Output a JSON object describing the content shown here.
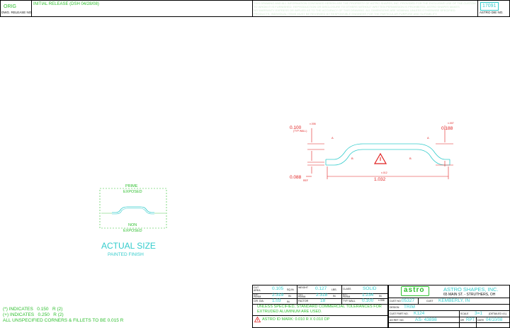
{
  "header": {
    "rev": "ORIG",
    "rev_label": "DWG. RELEASE NO.",
    "release_note": "INITIAL RELEASE (DSH 04/28/08)",
    "disclaimer_line1": "THIS DRAWING AND ALL INFORMATION CONTAINED HEREIN ARE THE PROPERTY OF ASTRO SHAPES, INC. PROVIDED FOR THE EXCLUSIVE USE OF THE CUSTOMER",
    "disclaimer_line2": "TO WHOM IT IS FURNISHED. REPRODUCTION OR DISCLOSURE TO OTHERS WITHOUT WRITTEN PERMISSION IS PROHIBITED. ASTRO SHAPES MAKES",
    "disclaimer_line3": "NO WARRANTY EXPRESS OR IMPLIED AS TO THE ACCURACY OF THIS DRAWING. ALL DIMENSIONS ARE NOMINAL UNLESS OTHERWISE SPECIFIED.",
    "disclaimer_line4": "PRODUCTS, INDIVIDUAL ITEMS MUST BE REVIEWED BY RESPONSIBLE ENGINEER FOR THE PARTICULAR PURPOSE AND SUITABILITY.",
    "die_no": "17091",
    "die_label": "ASTRO DIE NO."
  },
  "profile_drawing": {
    "dim_wall": "0.100",
    "dim_wall_tol": "±.006",
    "dim_wall_note": "(TYP WALL)",
    "dim_height": "0.188",
    "dim_height_tol": "±.007",
    "dim_ref": "0.088",
    "dim_ref_note": "REF",
    "dim_width": "1.032",
    "dim_width_tol": "±.012",
    "mark_a": "A",
    "mark_b": "B"
  },
  "actual_size": {
    "prime_label": "PRIME",
    "exposed_label_top": "EXPOSED",
    "non_label": "NON",
    "exposed_label_bottom": "EXPOSED",
    "title": "ACTUAL SIZE",
    "subtitle": "PAINTED FINISH"
  },
  "notes": {
    "line1": "(*) INDICATES   0.150   R (2)",
    "line2": "(+) INDICATES   0.250   R (2)",
    "line3": "ALL UNSPECIFIED CORNERS & FILLETS TO BE 0.015 R"
  },
  "specs": {
    "row1": [
      {
        "label": "CUT AREA",
        "value": "0.105",
        "unit": "SQ.IN."
      },
      {
        "label": "WEIGHT",
        "value": "0.127",
        "unit": "LBS."
      },
      {
        "label": "CLASS",
        "value": "SOLID",
        "unit": ""
      }
    ],
    "row2": [
      {
        "label": "EXP. PERIM.",
        "value": "2.319",
        "unit": "IN."
      },
      {
        "label": "TOT. PERIM.",
        "value": "2.318",
        "unit": "IN."
      },
      {
        "label": "EXT. PERIM.",
        "value": "1.234",
        "unit": "IN."
      }
    ],
    "row3": [
      {
        "label": "CIR. DIA.",
        "value": "1.03",
        "unit": "IN."
      },
      {
        "label": "FACTOR",
        "value": "18",
        "unit": ""
      },
      {
        "label": "TYP. WALL",
        "value": "0.100",
        "unit": "±.006"
      }
    ],
    "tolerance_note1": "UNLESS SPECIFIED, STANDARD COMMERCIAL TOLERANCES FOR",
    "tolerance_note2": "EXTRUDED ALUMINUM ARE USED.",
    "id_mark": "ASTRO ID MARK: 0.010 R X 0.010 DP"
  },
  "title_block": {
    "logo": "astro",
    "company": "ASTRO SHAPES, INC.",
    "address": "65 MAIN ST. - STRUTHERS, OH",
    "cust_no_label": "CUST NO.",
    "cust_no": "05327",
    "cust_label": "CUST",
    "cust": "KEMBERLY, IN",
    "design_label": "DESIGN",
    "design": "TRIM",
    "cust_part_label": "CUST PART NO.",
    "cust_part": "K124",
    "scale_label": "SCALE",
    "scale": "3=1",
    "scale_note": "(DETAILED 4:1)",
    "as_ref_label": "AS REF. NO.",
    "as_ref": "AS- 43898",
    "dr_label": "DR",
    "dr": "RPT",
    "date_label": "DATE",
    "date": "04/10/08"
  },
  "colors": {
    "title_green": "#2dbf2d",
    "cyan": "#33cccc",
    "dimension_red": "#e02020"
  }
}
